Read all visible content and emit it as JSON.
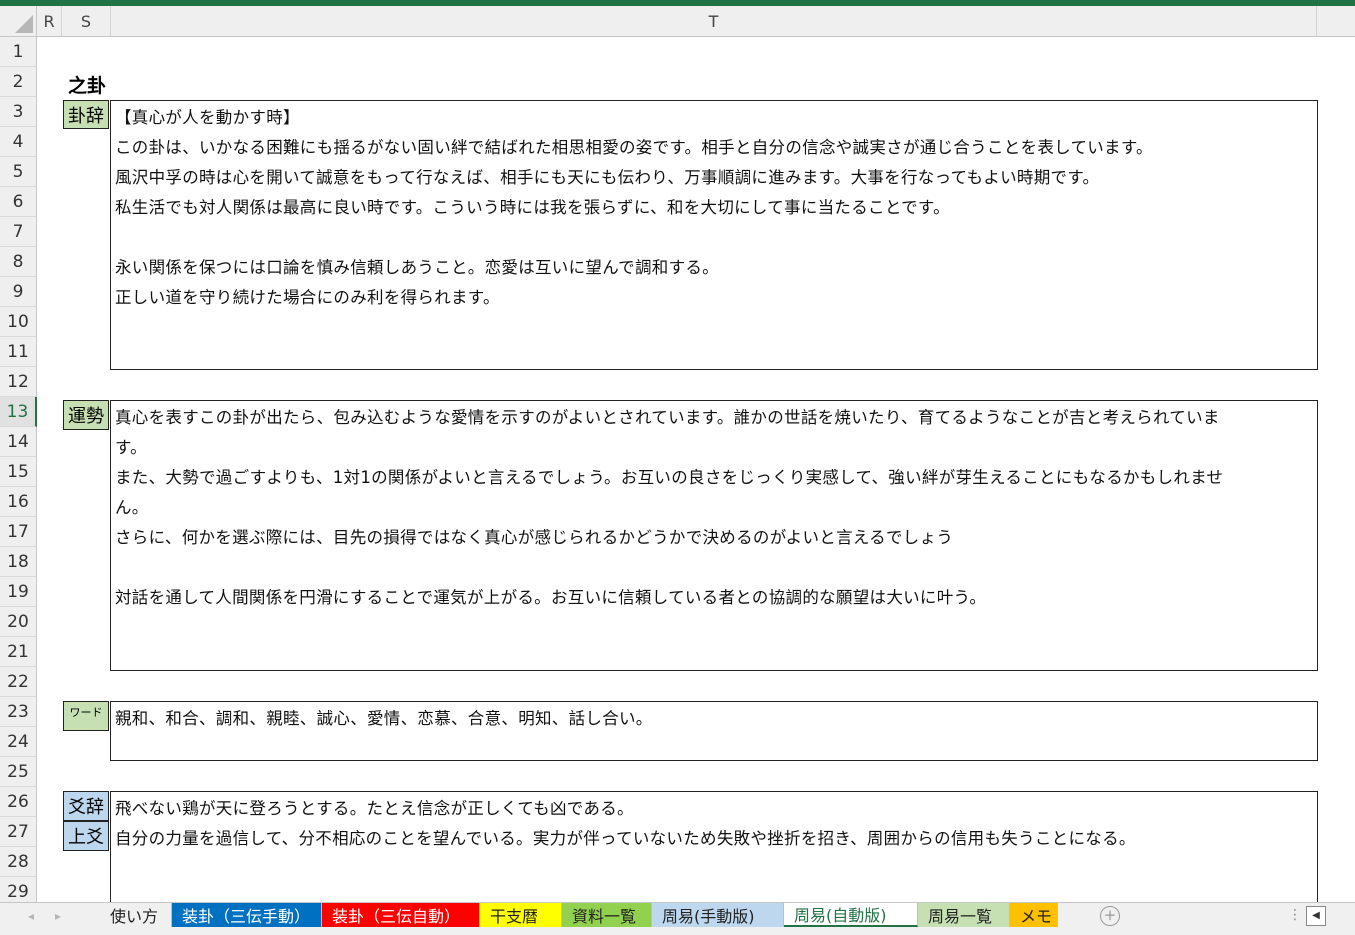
{
  "columns": {
    "r": "R",
    "s": "S",
    "t": "T"
  },
  "rows": [
    "1",
    "2",
    "3",
    "4",
    "5",
    "6",
    "7",
    "8",
    "9",
    "10",
    "11",
    "12",
    "13",
    "14",
    "15",
    "16",
    "17",
    "18",
    "19",
    "20",
    "21",
    "22",
    "23",
    "24",
    "25",
    "26",
    "27",
    "28",
    "29"
  ],
  "active_row": "13",
  "section_title": "之卦",
  "sections": {
    "kaji": {
      "label": "卦辞",
      "lines": [
        "【真心が人を動かす時】",
        "この卦は、いかなる困難にも揺るがない固い絆で結ばれた相思相愛の姿です。相手と自分の信念や誠実さが通じ合うことを表しています。",
        "風沢中孚の時は心を開いて誠意をもって行なえば、相手にも天にも伝わり、万事順調に進みます。大事を行なってもよい時期です。",
        "私生活でも対人関係は最高に良い時です。こういう時には我を張らずに、和を大切にして事に当たることです。",
        "",
        "永い関係を保つには口論を慎み信頼しあうこと。恋愛は互いに望んで調和する。",
        "正しい道を守り続けた場合にのみ利を得られます。"
      ]
    },
    "unsei": {
      "label": "運勢",
      "lines": [
        "真心を表すこの卦が出たら、包み込むような愛情を示すのがよいとされています。誰かの世話を焼いたり、育てるようなことが吉と考えられていま",
        "す。",
        "また、大勢で過ごすよりも、1対1の関係がよいと言えるでしょう。お互いの良さをじっくり実感して、強い絆が芽生えることにもなるかもしれませ",
        "ん。",
        "さらに、何かを選ぶ際には、目先の損得ではなく真心が感じられるかどうかで決めるのがよいと言えるでしょう",
        "",
        "対話を通して人間関係を円滑にすることで運気が上がる。お互いに信頼している者との協調的な願望は大いに叶う。"
      ]
    },
    "word": {
      "label": "ワード",
      "lines": [
        "親和、和合、調和、親睦、誠心、愛情、恋慕、合意、明知、話し合い。"
      ]
    },
    "kouji": {
      "label": "爻辞",
      "sublabel": "上爻",
      "lines": [
        "飛べない鶏が天に登ろうとする。たとえ信念が正しくても凶である。",
        "自分の力量を過信して、分不相応のことを望んでいる。実力が伴っていないため失敗や挫折を招き、周囲からの信用も失うことになる。"
      ]
    }
  },
  "tabs": [
    {
      "label": "使い方",
      "bg": "#f0f0f0",
      "fg": "#222222"
    },
    {
      "label": "装卦（三伝手動）",
      "bg": "#0070c0",
      "fg": "#ffffff"
    },
    {
      "label": "装卦（三伝自動）",
      "bg": "#ff0000",
      "fg": "#ffffff"
    },
    {
      "label": "干支暦",
      "bg": "#ffff00",
      "fg": "#222222"
    },
    {
      "label": "資料一覧",
      "bg": "#92d050",
      "fg": "#222222"
    },
    {
      "label": "周易(手動版)",
      "bg": "#bdd7ee",
      "fg": "#222222"
    },
    {
      "label": "周易(自動版)",
      "bg": "#ffffff",
      "fg": "#217346"
    },
    {
      "label": "周易一覧",
      "bg": "#c6e0b4",
      "fg": "#222222"
    },
    {
      "label": "メモ",
      "bg": "#ffc000",
      "fg": "#222222"
    }
  ],
  "active_tab": "周易(自動版)",
  "icons": {
    "prev": "◂",
    "next": "▸",
    "add": "+",
    "more": "⋮",
    "scroll_left": "◀"
  },
  "colors": {
    "excel_green": "#217346",
    "label_green": "#c6e0b4",
    "label_blue": "#bdd7ee"
  }
}
